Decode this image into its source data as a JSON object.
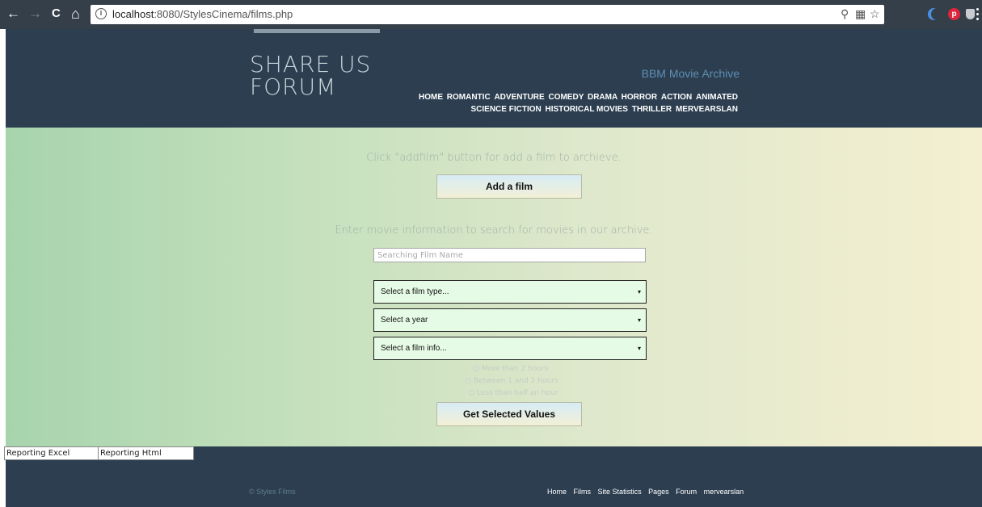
{
  "browser": {
    "back_icon": "←",
    "forward_icon": "→",
    "reload_icon": "C",
    "home_icon": "⌂",
    "url_host": "localhost",
    "url_rest": ":8080/StylesCinema/films.php"
  },
  "header": {
    "logo_line1": "SHARE US",
    "logo_line2": "FORUM",
    "brand": "BBM Movie Archive",
    "nav_row1": [
      "HOME",
      "ROMANTIC",
      "ADVENTURE",
      "COMEDY",
      "DRAMA",
      "HORROR",
      "ACTION",
      "ANIMATED"
    ],
    "nav_row2": [
      "SCIENCE FICTION",
      "HISTORICAL MOVIES",
      "THRILLER",
      "MERVEARSLAN"
    ]
  },
  "main": {
    "add_hint": "Click \"addfilm\" button for add a film to archieve.",
    "add_button": "Add a film",
    "search_hint": "Enter movie information to search for movies in our archive.",
    "search_placeholder": "Searching Film Name",
    "select_type": "Select a film type...",
    "select_year": "Select a year",
    "select_info": "Select a film info...",
    "radio_options": [
      "More than 2 hours",
      "Between 1 and 2 hours",
      "Less than half an hour"
    ],
    "submit_button": "Get Selected Values"
  },
  "reporting": {
    "excel": "Reporting Excel",
    "html": "Reporting Html"
  },
  "footer": {
    "copyright": "© Styles Films",
    "links": [
      "Home",
      "Films",
      "Site Statistics",
      "Pages",
      "Forum",
      "mervearslan"
    ]
  }
}
